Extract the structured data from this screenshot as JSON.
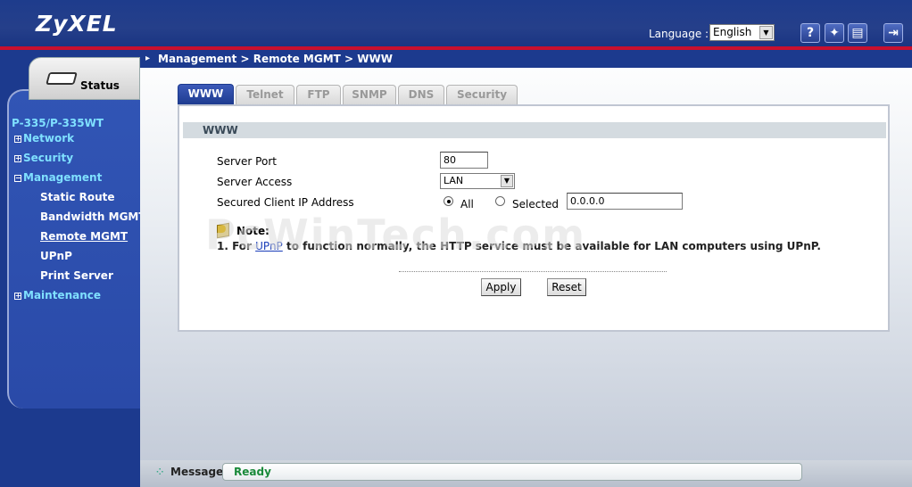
{
  "header": {
    "logo": "ZyXEL",
    "language_label": "Language :",
    "language_value": "English",
    "icons": [
      "help-icon",
      "wizard-icon",
      "logs-icon",
      "logout-icon"
    ]
  },
  "sidebar": {
    "status_label": "Status",
    "model": "P-335/P-335WT",
    "items": [
      {
        "label": "Network",
        "expander": "+"
      },
      {
        "label": "Security",
        "expander": "+"
      },
      {
        "label": "Management",
        "expander": "−"
      },
      {
        "label": "Static Route"
      },
      {
        "label": "Bandwidth MGMT"
      },
      {
        "label": "Remote MGMT"
      },
      {
        "label": "UPnP"
      },
      {
        "label": "Print Server"
      },
      {
        "label": "Maintenance",
        "expander": "+"
      }
    ]
  },
  "breadcrumb": "Management > Remote MGMT > WWW",
  "tabs": [
    "WWW",
    "Telnet",
    "FTP",
    "SNMP",
    "DNS",
    "Security"
  ],
  "section_title": "WWW",
  "form": {
    "server_port_label": "Server Port",
    "server_port_value": "80",
    "server_access_label": "Server Access",
    "server_access_value": "LAN",
    "secured_ip_label": "Secured Client IP Address",
    "radio_all": "All",
    "radio_selected": "Selected",
    "ip_value": "0.0.0.0"
  },
  "note": {
    "title": "Note:",
    "prefix": "1. For ",
    "link": "UPnP",
    "suffix": " to function normally, the HTTP service must be available for LAN computers using UPnP."
  },
  "buttons": {
    "apply": "Apply",
    "reset": "Reset"
  },
  "message": {
    "label": "Message",
    "value": "Ready"
  },
  "watermark": "PcWinTech.com"
}
